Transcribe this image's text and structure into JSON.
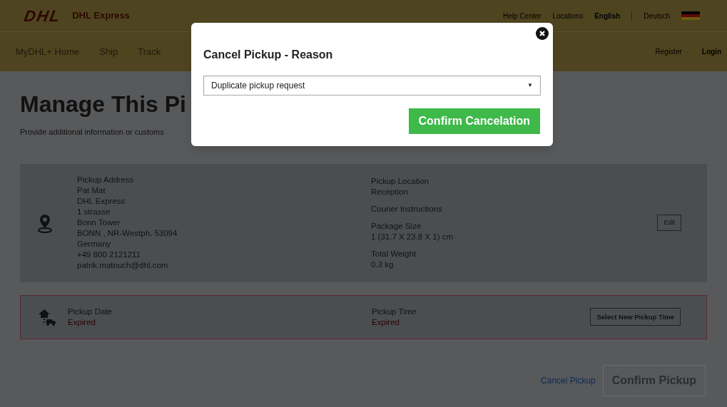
{
  "header": {
    "logo": "DHL",
    "brand": "DHL Express",
    "top_links": [
      "Help Center",
      "Locations"
    ],
    "languages": [
      {
        "label": "English",
        "selected": true
      },
      {
        "label": "Deutsch",
        "selected": false
      }
    ],
    "nav": [
      "MyDHL+ Home",
      "Ship",
      "Track"
    ],
    "account": [
      {
        "label": "Register",
        "selected": false
      },
      {
        "label": "Login",
        "selected": true
      }
    ]
  },
  "page": {
    "title": "Manage This Pi",
    "subtitle": "Provide additional information or customs"
  },
  "pickup_card": {
    "address_lines": [
      "Pickup Address",
      "Pat Mat",
      "DHL Express",
      "1 strasse",
      "Bonn Tower",
      "BONN , NR-Westph. 53094",
      "Germany",
      "+49 800 2121211",
      "patrik.matouch@dhl.com"
    ],
    "details": [
      {
        "label": "Pickup Location",
        "value": "Reception"
      },
      {
        "label": "Courier Instructions"
      },
      {
        "label": "Package Size",
        "value": "1 (31.7 X 23.8 X 1) cm"
      },
      {
        "label": "Total Weight",
        "value": "0.3 kg"
      }
    ],
    "edit_button": "Edit"
  },
  "time_card": {
    "fields": [
      {
        "label": "Pickup Date",
        "value": "Expired"
      },
      {
        "label": "Pickup Time",
        "value": "Expired"
      }
    ],
    "button": "Select New Pickup Time"
  },
  "actions": {
    "cancel_link": "Cancel Pickup",
    "confirm_button": "Confirm Pickup",
    "confirm_disabled": true
  },
  "modal": {
    "title": "Cancel Pickup - Reason",
    "select_value": "Duplicate pickup request",
    "select_arrow": "▼",
    "confirm_button": "Confirm Cancelation"
  }
}
